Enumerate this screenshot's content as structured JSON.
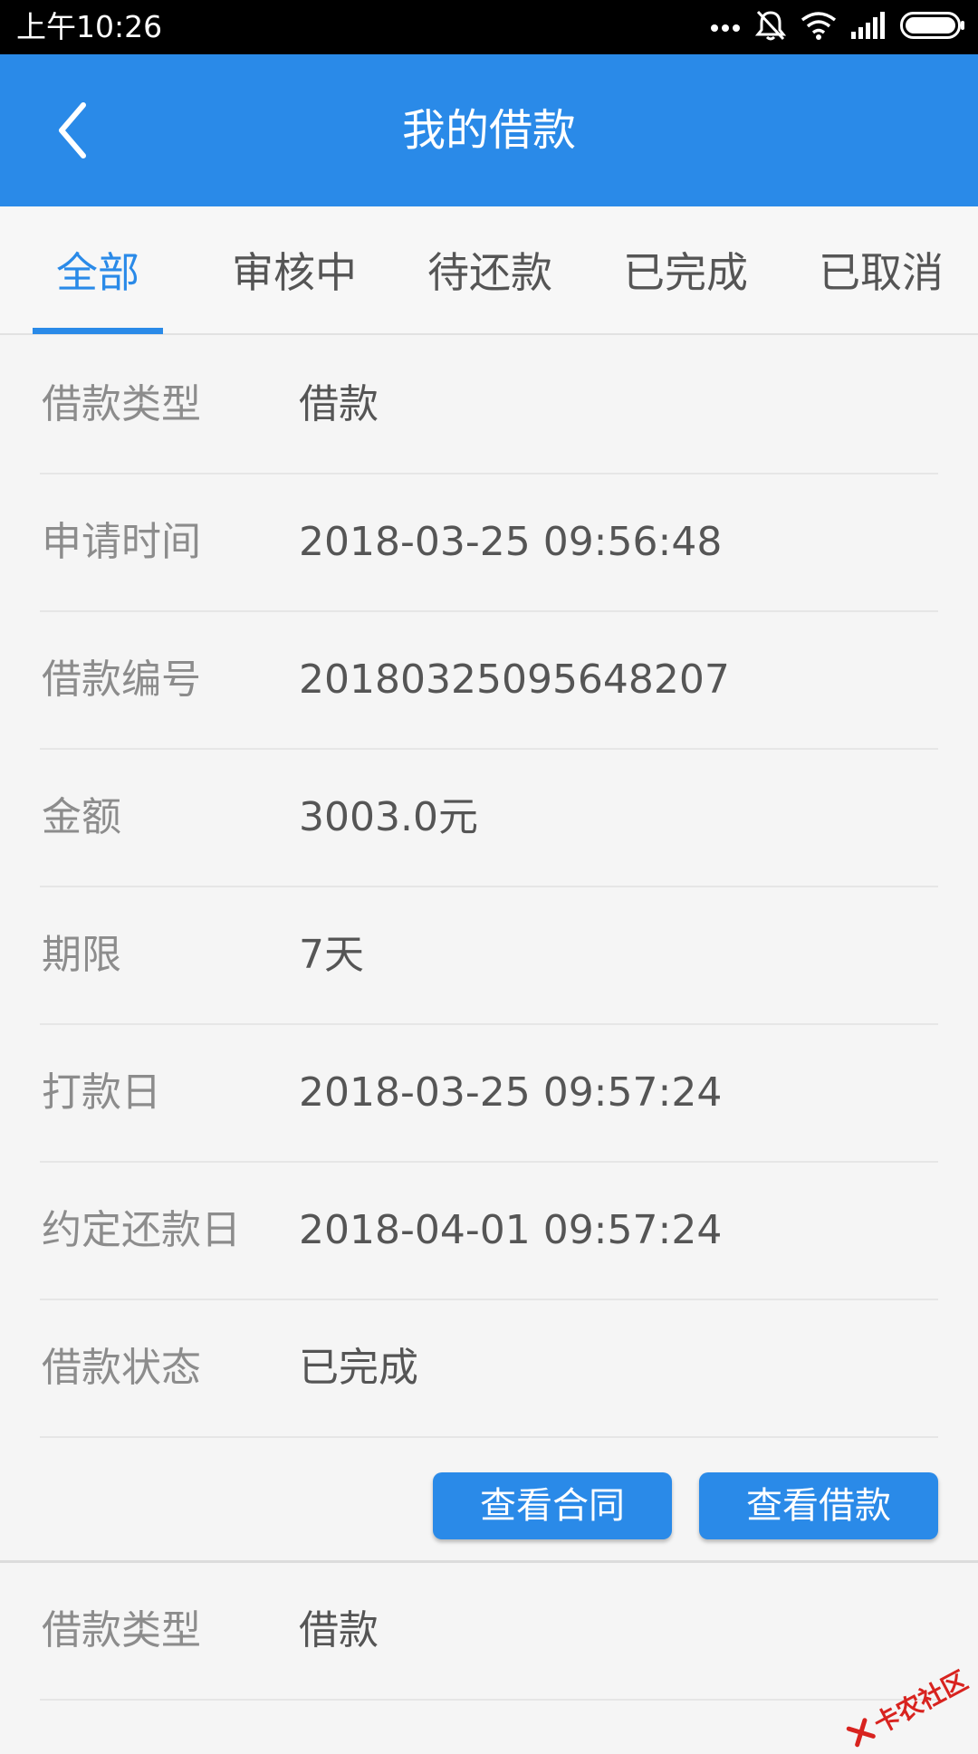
{
  "status_bar": {
    "time": "上午10:26",
    "icons": [
      "more-dots-icon",
      "mute-bell-icon",
      "wifi-icon",
      "signal-icon",
      "battery-icon"
    ]
  },
  "app_bar": {
    "title": "我的借款",
    "back_icon": "back-arrow-icon"
  },
  "tabs": [
    {
      "label": "全部",
      "active": true
    },
    {
      "label": "审核中",
      "active": false
    },
    {
      "label": "待还款",
      "active": false
    },
    {
      "label": "已完成",
      "active": false
    },
    {
      "label": "已取消",
      "active": false
    }
  ],
  "loan": {
    "rows": [
      {
        "label": "借款类型",
        "value": "借款"
      },
      {
        "label": "申请时间",
        "value": "2018-03-25 09:56:48"
      },
      {
        "label": "借款编号",
        "value": "20180325095648207"
      },
      {
        "label": "金额",
        "value": "3003.0元"
      },
      {
        "label": "期限",
        "value": "7天"
      },
      {
        "label": "打款日",
        "value": "2018-03-25 09:57:24"
      },
      {
        "label": "约定还款日",
        "value": "2018-04-01 09:57:24"
      },
      {
        "label": "借款状态",
        "value": "已完成"
      }
    ],
    "actions": {
      "view_contract": "查看合同",
      "view_loan": "查看借款"
    }
  },
  "next_loan": {
    "rows": [
      {
        "label": "借款类型",
        "value": "借款"
      }
    ]
  },
  "watermark": {
    "text": "卡农社区"
  },
  "colors": {
    "primary": "#2a8ae8",
    "label_gray": "#8c8c8c",
    "value_gray": "#555555",
    "background": "#f5f5f5"
  }
}
